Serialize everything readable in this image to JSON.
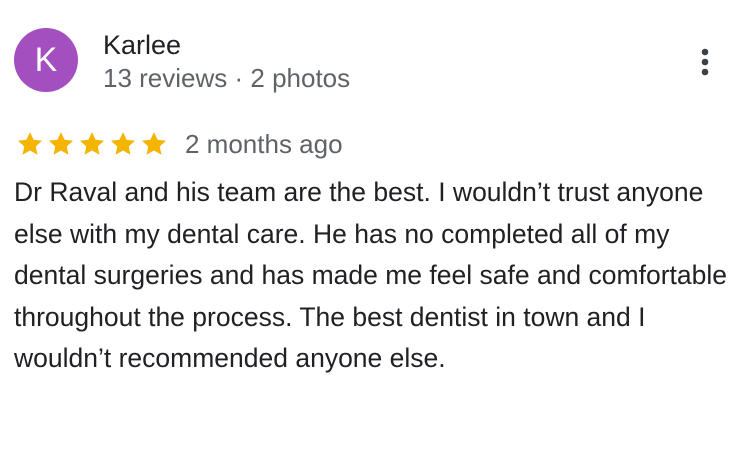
{
  "review": {
    "author": {
      "initial": "K",
      "name": "Karlee",
      "meta": "13 reviews · 2 photos"
    },
    "rating": {
      "stars": 5,
      "max": 5,
      "date": "2 months ago"
    },
    "text": "Dr Raval and his team are the best. I wouldn’t trust anyone else with my dental care. He has no completed all of my dental surgeries and has made me feel safe and comfortable throughout the process. The best dentist in town and I wouldn’t recommended anyone else."
  },
  "icons": {
    "star": "star-icon",
    "more": "more-vertical-icon"
  },
  "colors": {
    "avatar_bg": "#a44fc0",
    "star": "#f4b400",
    "secondary_text": "#5f6368",
    "primary_text": "#202124"
  }
}
